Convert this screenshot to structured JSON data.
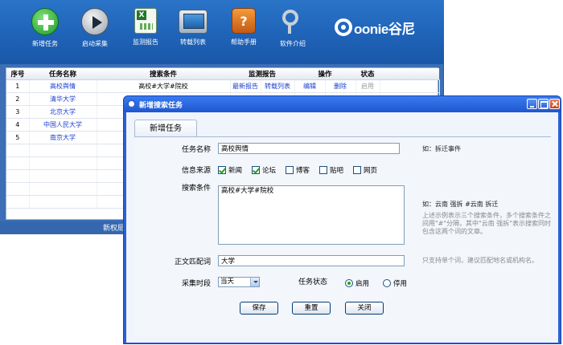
{
  "toolbar": {
    "buttons": [
      {
        "label": "新增任务"
      },
      {
        "label": "启动采集"
      },
      {
        "label": "监测报告"
      },
      {
        "label": "转载列表"
      },
      {
        "label": "帮助手册"
      },
      {
        "label": "软件介绍"
      }
    ],
    "logo_text": "oonie谷尼"
  },
  "task_table": {
    "headers": [
      "序号",
      "任务名称",
      "搜索条件",
      "监测报告",
      "操作",
      "状态"
    ],
    "rows": [
      {
        "no": "1",
        "name": "高校舆情",
        "condition": "高校#大学#院校",
        "report": "最新报告",
        "repost": "转载列表",
        "edit": "编辑",
        "delete": "删除",
        "status": "启用"
      },
      {
        "no": "2",
        "name": "清华大学"
      },
      {
        "no": "3",
        "name": "北京大学"
      },
      {
        "no": "4",
        "name": "中国人民大学"
      },
      {
        "no": "5",
        "name": "南京大学"
      }
    ]
  },
  "main_status": {
    "text": "新权局"
  },
  "dialog": {
    "title": "新增搜索任务",
    "tab_label": "新增任务",
    "task_name": {
      "label": "任务名称",
      "value": "高校舆情",
      "hint": "如：拆迁事件"
    },
    "source": {
      "label": "信息来源",
      "options": [
        {
          "label": "新闻",
          "checked": true
        },
        {
          "label": "论坛",
          "checked": true
        },
        {
          "label": "博客",
          "checked": false
        },
        {
          "label": "贴吧",
          "checked": false
        },
        {
          "label": "网页",
          "checked": false
        }
      ]
    },
    "conditions": {
      "label": "搜索条件",
      "value": "高校#大学#院校",
      "hint_example": "如：云南 强拆 #云南 拆迁",
      "hint_desc": "上述示例表示三个搜索条件，多个搜索条件之间用\"#\"分隔，其中\"云南 强拆\"表示搜索同时包含这两个词的文章。"
    },
    "match_word": {
      "label": "正文匹配词",
      "value": "大学",
      "hint": "只支持单个词，建议匹配地名或机构名。"
    },
    "period": {
      "label": "采集时段",
      "value": "当天"
    },
    "task_status": {
      "label": "任务状态",
      "options": [
        {
          "label": "启用",
          "selected": true
        },
        {
          "label": "停用",
          "selected": false
        }
      ]
    },
    "buttons": {
      "save": "保存",
      "reset": "重置",
      "close": "关闭"
    }
  },
  "colors": {
    "accent": "#2c61d6",
    "toolbar": "#1f63b8",
    "link": "#1a3fd0"
  }
}
